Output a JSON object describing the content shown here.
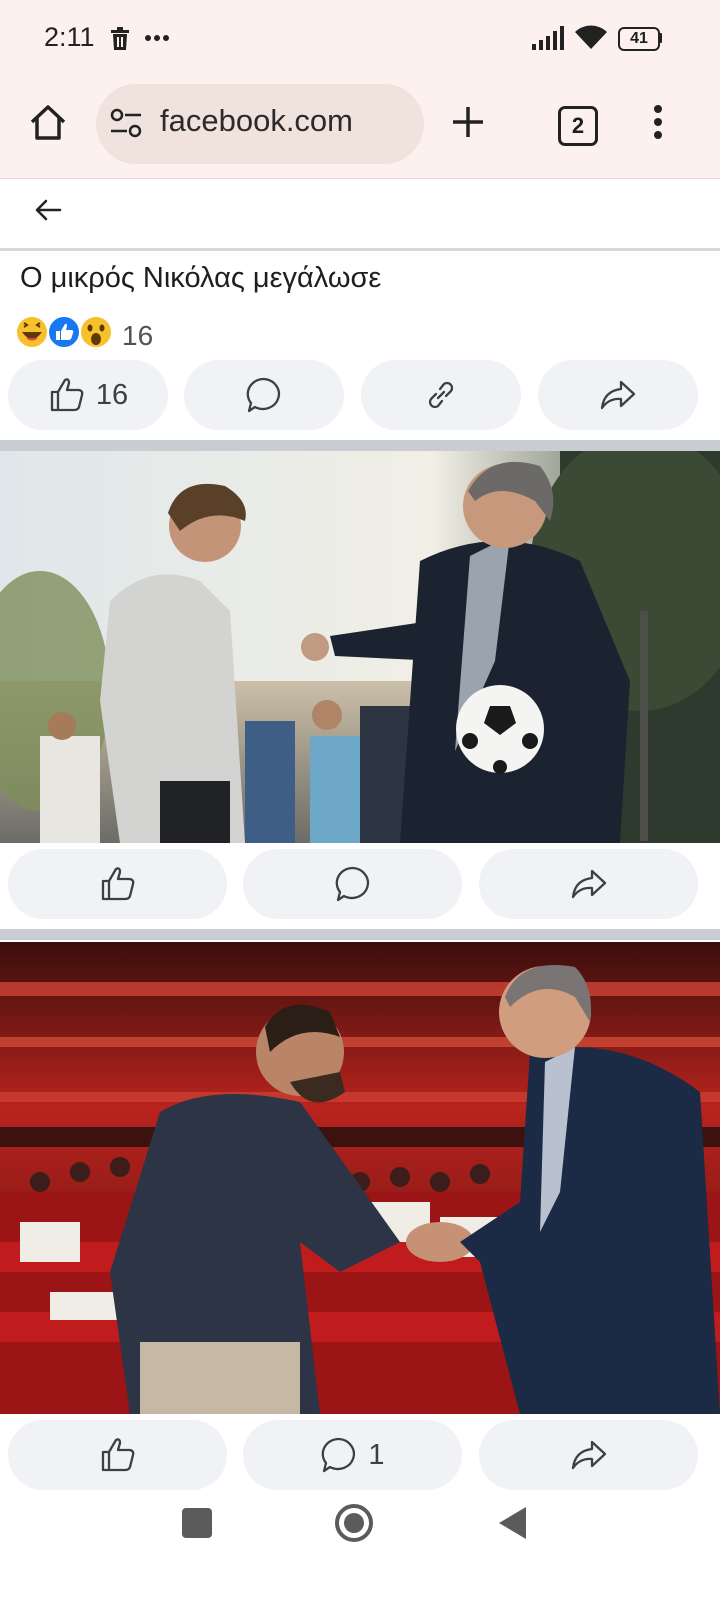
{
  "status_bar": {
    "time": "2:11",
    "battery": "41"
  },
  "browser": {
    "url": "facebook.com",
    "tab_count": "2"
  },
  "post": {
    "title": "Ο μικρός Νικόλας μεγάλωσε",
    "reaction_total": "16",
    "actions": {
      "like_count": "16"
    }
  },
  "photos": [
    {
      "description": "man-and-boy-with-football",
      "actions": {
        "like_count": "",
        "comment_count": ""
      }
    },
    {
      "description": "two-men-shaking-hands-in-theater",
      "actions": {
        "like_count": "",
        "comment_count": "1"
      }
    }
  ],
  "colors": {
    "browser_bg": "#fcf1ee",
    "button_bg": "#f0f2f5",
    "like_blue": "#1877f2",
    "divider": "#c9ccd1"
  }
}
